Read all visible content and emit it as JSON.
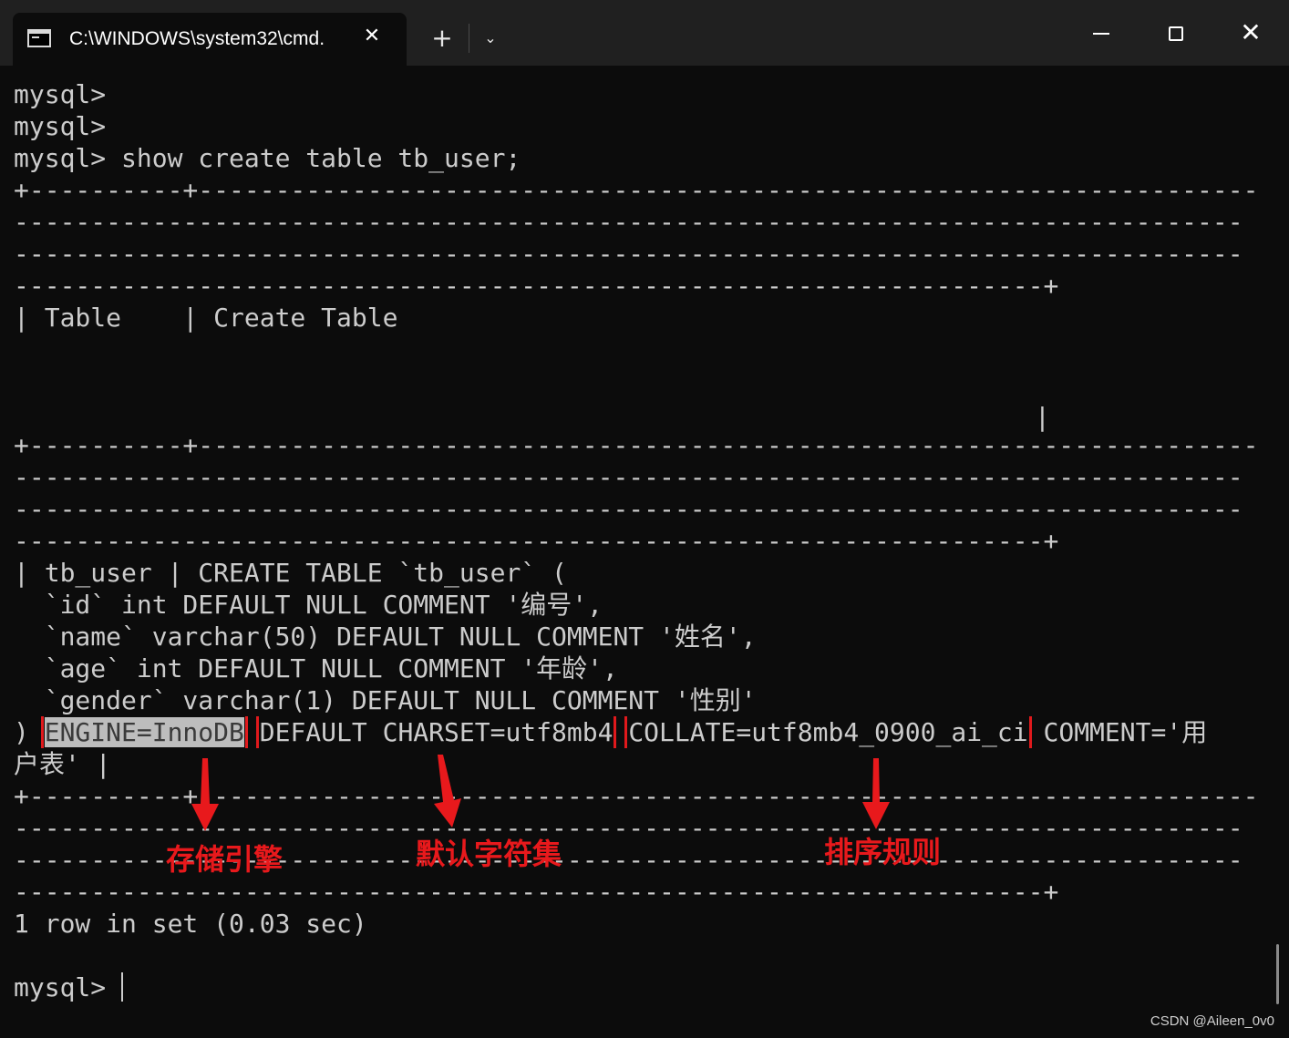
{
  "window": {
    "tab_title": "C:\\WINDOWS\\system32\\cmd.",
    "tab_icon": "cmd-icon",
    "tab_close": "✕",
    "new_tab": "+",
    "dropdown": "⌄",
    "close": "✕"
  },
  "console": {
    "lines": [
      "mysql>",
      "mysql>",
      "mysql> show create table tb_user;",
      "+----------+-----------------------------------------------------------------------",
      "--------------------------------------------------------------------------------",
      "--------------------------------------------------------------------------------",
      "-------------------------------------------------------------------+",
      "| Table    | Create Table",
      "",
      "",
      "",
      "+----------+-----------------------------------------------------------------------",
      "--------------------------------------------------------------------------------",
      "--------------------------------------------------------------------------------",
      "-------------------------------------------------------------------+",
      "| tb_user | CREATE TABLE `tb_user` (",
      "  `id` int DEFAULT NULL COMMENT '编号',",
      "  `name` varchar(50) DEFAULT NULL COMMENT '姓名',",
      "  `age` int DEFAULT NULL COMMENT '年龄',",
      "  `gender` varchar(1) DEFAULT NULL COMMENT '性别'"
    ],
    "table_end_pipe": "|",
    "engine_line": {
      "prefix": ") ",
      "engine": "ENGINE=InnoDB",
      "charset": "DEFAULT CHARSET=utf8mb4",
      "collate": "COLLATE=utf8mb4_0900_ai_ci",
      "suffix": " COMMENT='用"
    },
    "wrap_line": "户表' |",
    "lines_after": [
      "+----------+-----------------------------------------------------------------------",
      "--------------------------------------------------------------------------------",
      "--------------------------------------------------------------------------------",
      "-------------------------------------------------------------------+",
      "1 row in set (0.03 sec)",
      ""
    ],
    "prompt": "mysql> "
  },
  "annotations": {
    "engine": "存储引擎",
    "charset": "默认字符集",
    "collate": "排序规则",
    "color": "#e8191c"
  },
  "watermark": "CSDN @Aileen_0v0"
}
